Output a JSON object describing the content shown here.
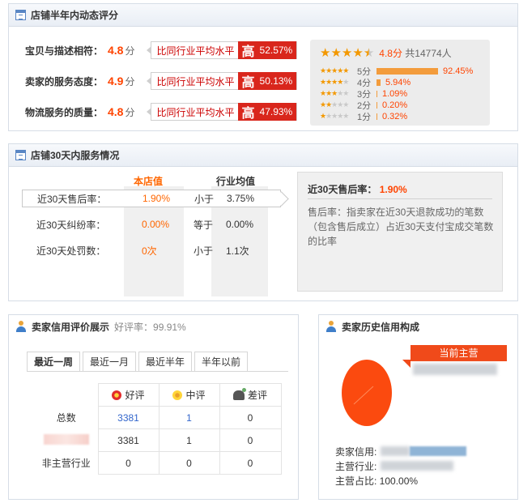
{
  "dsr": {
    "title": "店铺半年内动态评分",
    "compare_text": "比同行业平均水平",
    "high": "高",
    "unit": "分",
    "rows": [
      {
        "label": "宝贝与描述相符：",
        "score": "4.8",
        "pct": "52.57%"
      },
      {
        "label": "卖家的服务态度：",
        "score": "4.9",
        "pct": "50.13%"
      },
      {
        "label": "物流服务的质量：",
        "score": "4.8",
        "pct": "47.93%"
      }
    ],
    "summary_score": "4.8分",
    "summary_total": "共14774人",
    "distribution": [
      {
        "label": "5分",
        "pct": "92.45%",
        "value": 92.45
      },
      {
        "label": "4分",
        "pct": "5.94%",
        "value": 5.94
      },
      {
        "label": "3分",
        "pct": "1.09%",
        "value": 1.09
      },
      {
        "label": "2分",
        "pct": "0.20%",
        "value": 0.2
      },
      {
        "label": "1分",
        "pct": "0.32%",
        "value": 0.32
      }
    ]
  },
  "service": {
    "title": "店铺30天内服务情况",
    "col_shop": "本店值",
    "col_industry": "行业均值",
    "rows": [
      {
        "name": "近30天售后率：",
        "shop": "1.90%",
        "cmp": "小于",
        "industry": "3.75%"
      },
      {
        "name": "近30天纠纷率：",
        "shop": "0.00%",
        "cmp": "等于",
        "industry": "0.00%"
      },
      {
        "name": "近30天处罚数：",
        "shop": "0次",
        "cmp": "小于",
        "industry": "1.1次"
      }
    ],
    "info_title": "近30天售后率：",
    "info_value": "1.90%",
    "info_desc": "售后率：指卖家在近30天退款成功的笔数（包含售后成立）占近30天支付宝成交笔数的比率"
  },
  "credit": {
    "title": "卖家信用评价展示",
    "good_rate": "好评率：99.91%",
    "tabs": [
      "最近一周",
      "最近一月",
      "最近半年",
      "半年以前"
    ],
    "headers": [
      "好评",
      "中评",
      "差评"
    ],
    "rows": [
      {
        "label": "总数",
        "good": "3381",
        "mid": "1",
        "bad": "0"
      },
      {
        "label": "",
        "good": "3381",
        "mid": "1",
        "bad": "0"
      },
      {
        "label": "非主营行业",
        "good": "0",
        "mid": "0",
        "bad": "0"
      }
    ]
  },
  "history": {
    "title": "卖家历史信用构成",
    "main_tag": "当前主营",
    "seller_credit_label": "卖家信用:",
    "main_industry_label": "主营行业:",
    "main_ratio_label": "主营占比: 100.00%",
    "pie_value": 100
  },
  "colors": {
    "accent": "#ff4400",
    "high_badge": "#d9261c",
    "pie": "#fb4a0f",
    "bar": "#f39c3c"
  }
}
